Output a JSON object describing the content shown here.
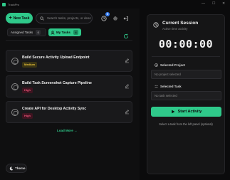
{
  "app": {
    "title": "TrackPro"
  },
  "window_controls": {
    "minimize": "—",
    "maximize": "☐",
    "close": "✕"
  },
  "header": {
    "new_task_label": "New Task",
    "search_placeholder": "Search tasks, projects, or descri",
    "notification_count": "0"
  },
  "tabs": {
    "assigned": {
      "label": "Assigned Tasks",
      "count": "0"
    },
    "mine": {
      "label": "My Tasks",
      "count": "4"
    }
  },
  "tasks": [
    {
      "title": "Build Secure Activity Upload Endpoint",
      "priority": "Medium"
    },
    {
      "title": "Build Task Screenshot Capture Pipeline",
      "priority": "High"
    },
    {
      "title": "Create API for Desktop Activity Sync",
      "priority": "High"
    }
  ],
  "load_more_label": "Load More →",
  "theme_label": "Theme",
  "session": {
    "title": "Current Session",
    "subtitle": "Active time activity",
    "timer": "00:00:00",
    "project_label": "Selected Project",
    "project_placeholder": "No project selected",
    "task_label": "Selected Task",
    "task_placeholder": "No task selected",
    "start_label": "Start Activity",
    "hint": "Select a task from the left panel (optional)"
  },
  "colors": {
    "accent": "#2fc98a",
    "background": "#0b0b0c",
    "medium": "#e9c23c",
    "high": "#f0547a"
  }
}
